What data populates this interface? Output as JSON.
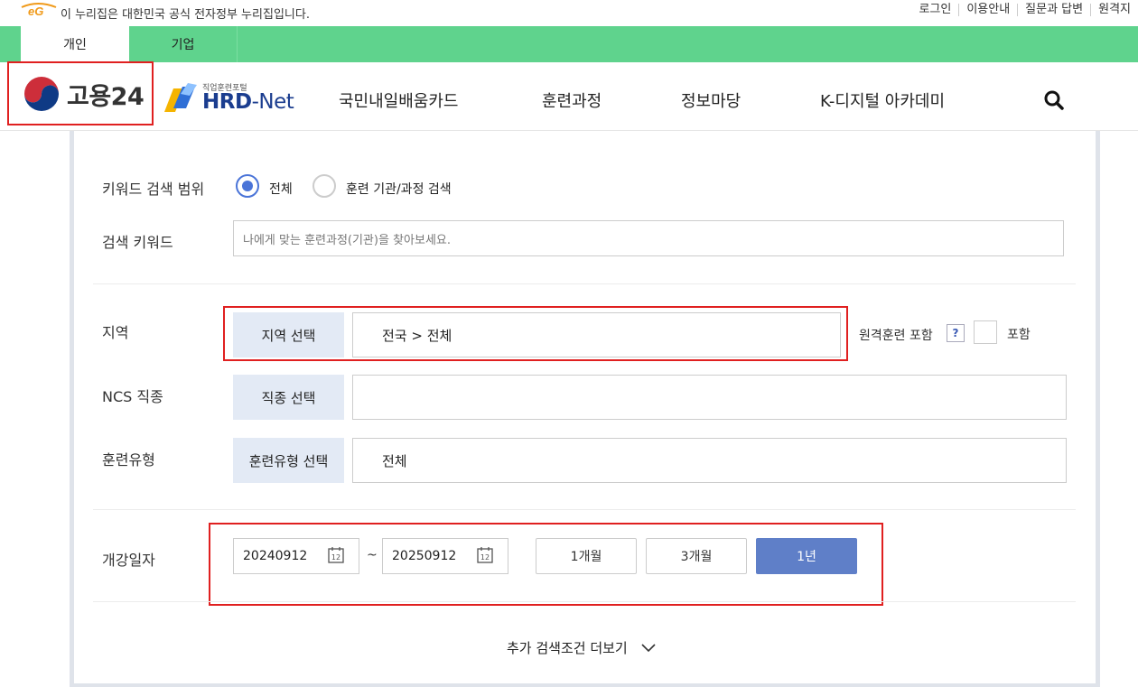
{
  "gov_banner": {
    "logo_text": "eG",
    "text": "이 누리집은 대한민국 공식 전자정부 누리집입니다.",
    "links": [
      "로그인",
      "이용안내",
      "질문과 답변",
      "원격지"
    ]
  },
  "tabs": [
    "개인",
    "기업"
  ],
  "header": {
    "logo_text": "고용24",
    "hrd_small": "직업훈련포털",
    "hrd_big": "HRD",
    "hrd_net": "-Net",
    "nav": [
      "국민내일배움카드",
      "훈련과정",
      "정보마당",
      "K-디지털 아카데미"
    ]
  },
  "form": {
    "keyword_scope_label": "키워드 검색 범위",
    "scope_options": [
      "전체",
      "훈련 기관/과정 검색"
    ],
    "keyword_label": "검색 키워드",
    "keyword_placeholder": "나에게 맞는 훈련과정(기관)을 찾아보세요.",
    "region_label": "지역",
    "region_button": "지역 선택",
    "region_value": "전국 > 전체",
    "remote_label": "원격훈련 포함",
    "help_icon": "?",
    "include_label": "포함",
    "ncs_label": "NCS 직종",
    "ncs_button": "직종 선택",
    "ncs_value": "",
    "type_label": "훈련유형",
    "type_button": "훈련유형 선택",
    "type_value": "전체",
    "date_label": "개강일자",
    "date_from": "20240912",
    "date_tilde": "~",
    "date_to": "20250912",
    "calendar_icon_text": "12",
    "periods": [
      "1개월",
      "3개월",
      "1년"
    ],
    "more_label": "추가 검색조건 더보기"
  },
  "colors": {
    "tab_green": "#5fd38d",
    "accent_blue": "#5f7fc8",
    "highlight_red": "#e02020",
    "button_bg": "#e3eaf5"
  }
}
